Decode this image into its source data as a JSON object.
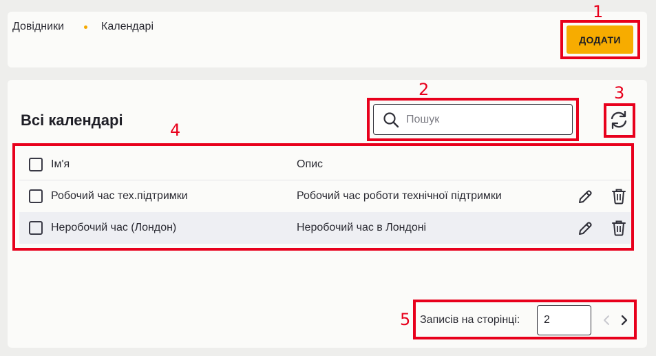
{
  "breadcrumb": {
    "items": [
      "Довідники",
      "Календарі"
    ]
  },
  "header": {
    "add_label": "ДОДАТИ"
  },
  "main": {
    "title": "Всі календарі",
    "search_placeholder": "Пошук"
  },
  "table": {
    "columns": {
      "name": "Ім'я",
      "description": "Опис"
    },
    "rows": [
      {
        "name": "Робочий час тех.підтримки",
        "description": "Робочий час роботи технічної підтримки"
      },
      {
        "name": "Неробочий час (Лондон)",
        "description": "Неробочий час в Лондоні"
      }
    ]
  },
  "pagination": {
    "per_page_label": "Записів на сторінці:",
    "per_page_value": "2"
  },
  "annotations": [
    "1",
    "2",
    "3",
    "4",
    "5"
  ],
  "colors": {
    "accent": "#f7ac00",
    "highlight": "#e8001c"
  }
}
